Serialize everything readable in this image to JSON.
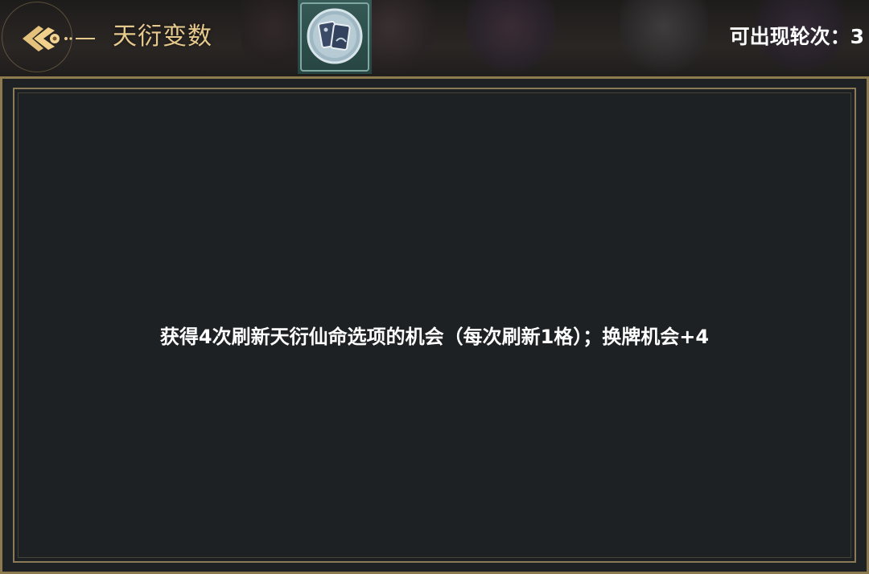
{
  "header": {
    "title": "天衍变数",
    "rounds_label": "可出现轮次：",
    "rounds_value": "3"
  },
  "icons": {
    "back": "back-arrow-icon",
    "selected_card": "cards-icon"
  },
  "panel": {
    "description": "获得4次刷新天衍仙命选项的机会（每次刷新1格）；换牌机会+4"
  },
  "colors": {
    "title_gold": "#e6c98d",
    "panel_bg": "#1e2124",
    "panel_border": "#8a7a56",
    "card_tile": "#365a57",
    "text_white": "#ffffff"
  }
}
